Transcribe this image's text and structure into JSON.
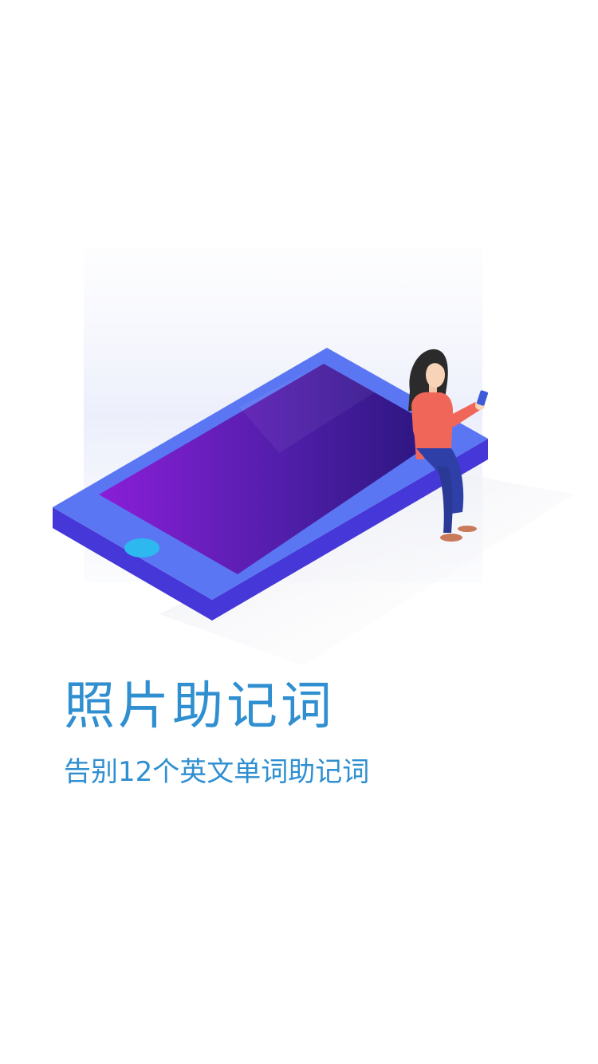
{
  "onboarding": {
    "title": "照片助记词",
    "subtitle": "告别12个英文单词助记词"
  },
  "colors": {
    "text_accent": "#2f8fd0",
    "phone_frame": "#4f6bf0",
    "phone_screen": "#5a1ec0",
    "home_button": "#2db8f0",
    "background": "#ffffff"
  }
}
